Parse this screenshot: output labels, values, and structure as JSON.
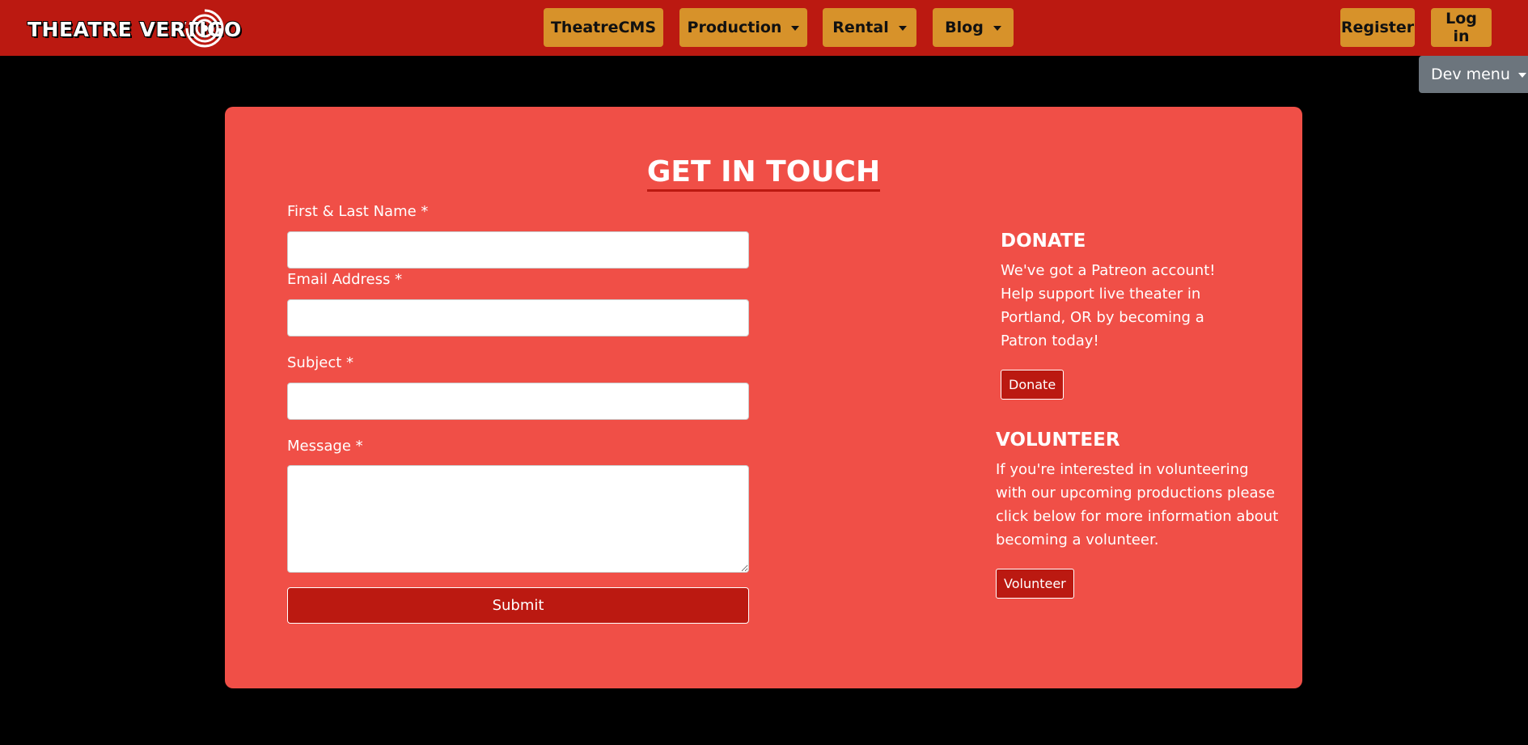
{
  "navbar": {
    "logo_text": "THEATRE VERTIGO",
    "items": [
      {
        "label": "TheatreCMS",
        "dropdown": false
      },
      {
        "label": "Production",
        "dropdown": true
      },
      {
        "label": "Rental",
        "dropdown": true
      },
      {
        "label": "Blog",
        "dropdown": true
      }
    ],
    "register_label": "Register",
    "login_label": "Log in",
    "dev_menu_label": "Dev menu"
  },
  "contact": {
    "title": "GET IN TOUCH",
    "fields": {
      "name_label": "First & Last Name *",
      "name_value": "",
      "email_label": "Email Address *",
      "email_value": "",
      "subject_label": "Subject *",
      "subject_value": "",
      "message_label": "Message *",
      "message_value": ""
    },
    "submit_label": "Submit"
  },
  "donate": {
    "heading": "DONATE",
    "text": "We've got a Patreon account! Help support live theater in Portland, OR by becoming a Patron today!",
    "button_label": "Donate"
  },
  "volunteer": {
    "heading": "VOLUNTEER",
    "text": "If you're interested in volunteering with our upcoming productions please click below for more information about becoming a volunteer.",
    "button_label": "Volunteer"
  },
  "colors": {
    "navbar_bg": "#bb1911",
    "nav_button_bg": "#d7922a",
    "card_bg": "#f04f47",
    "page_bg": "#000000",
    "dev_menu_bg": "#6c757d"
  },
  "icons": {
    "logo": "vertigo-spiral-icon",
    "dropdown": "caret-down-icon"
  }
}
